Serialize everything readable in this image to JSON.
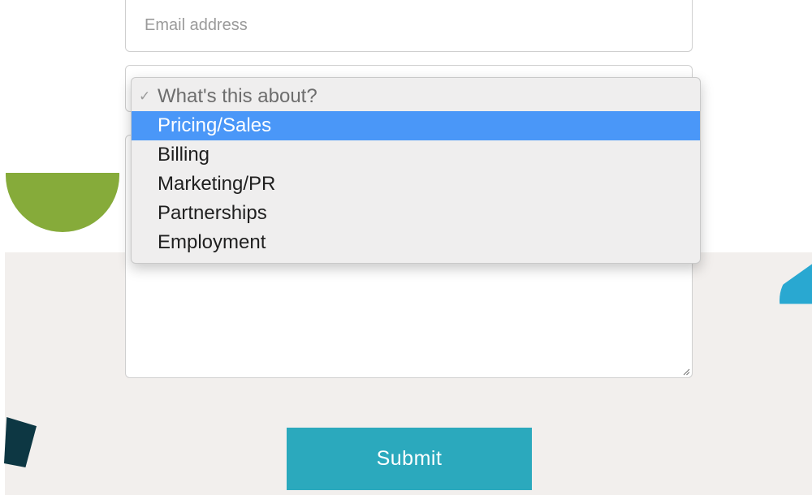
{
  "form": {
    "email_placeholder": "Email address",
    "topic_dropdown": {
      "prompt": "What's this about?",
      "selected": "Pricing/Sales",
      "options": [
        "Pricing/Sales",
        "Billing",
        "Marketing/PR",
        "Partnerships",
        "Employment"
      ]
    },
    "submit_label": "Submit"
  },
  "colors": {
    "submit_button": "#2ba9bd",
    "option_highlight": "#4a97f8",
    "background_band": "#f2efed",
    "decor_green": "#86ab3a",
    "decor_blue": "#29a8d1",
    "decor_dark": "#0d3743"
  },
  "icons": {
    "prompt_marker": "checkmark-icon",
    "message_resize": "resize-grip-icon"
  }
}
